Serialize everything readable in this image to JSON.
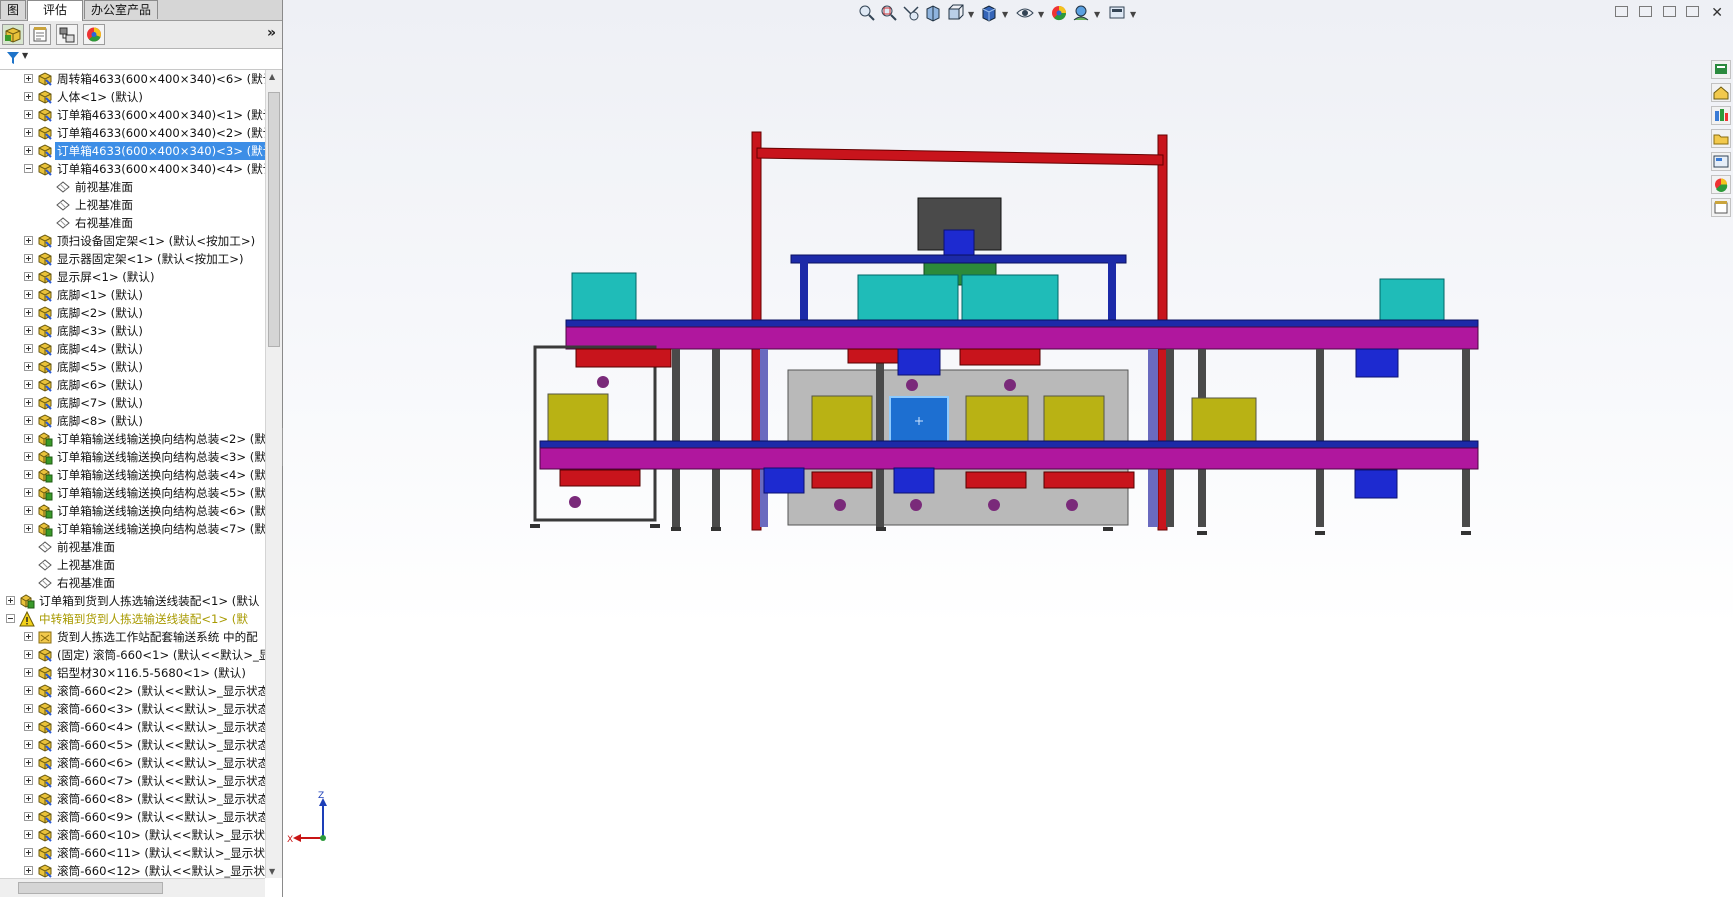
{
  "tabs": [
    {
      "label": "图"
    },
    {
      "label": "评估"
    },
    {
      "label": "办公室产品"
    }
  ],
  "feature_manager": {
    "toolbar_icons": [
      "feature-tree-icon",
      "property-manager-icon",
      "configuration-manager-icon",
      "display-manager-icon"
    ],
    "expand_glyph": "»",
    "filter_arrow": "▼"
  },
  "tree": [
    {
      "label": "周转箱4633(600×400×340)<6> (默认",
      "level": 1,
      "expander": "plus",
      "icon": "part"
    },
    {
      "label": "人体<1> (默认)",
      "level": 1,
      "expander": "plus",
      "icon": "part"
    },
    {
      "label": "订单箱4633(600×400×340)<1> (默认",
      "level": 1,
      "expander": "plus",
      "icon": "part"
    },
    {
      "label": "订单箱4633(600×400×340)<2> (默认",
      "level": 1,
      "expander": "plus",
      "icon": "part"
    },
    {
      "label": "订单箱4633(600×400×340)<3> (默认",
      "level": 1,
      "expander": "plus",
      "icon": "part",
      "selected": true
    },
    {
      "label": "订单箱4633(600×400×340)<4> (默认",
      "level": 1,
      "expander": "minus",
      "icon": "part"
    },
    {
      "label": "前视基准面",
      "level": 2,
      "expander": "none",
      "icon": "plane"
    },
    {
      "label": "上视基准面",
      "level": 2,
      "expander": "none",
      "icon": "plane"
    },
    {
      "label": "右视基准面",
      "level": 2,
      "expander": "none",
      "icon": "plane"
    },
    {
      "label": "顶扫设备固定架<1> (默认<按加工>)",
      "level": 1,
      "expander": "plus",
      "icon": "part"
    },
    {
      "label": "显示器固定架<1> (默认<按加工>)",
      "level": 1,
      "expander": "plus",
      "icon": "part"
    },
    {
      "label": "显示屏<1> (默认)",
      "level": 1,
      "expander": "plus",
      "icon": "part"
    },
    {
      "label": "底脚<1> (默认)",
      "level": 1,
      "expander": "plus",
      "icon": "part"
    },
    {
      "label": "底脚<2> (默认)",
      "level": 1,
      "expander": "plus",
      "icon": "part"
    },
    {
      "label": "底脚<3> (默认)",
      "level": 1,
      "expander": "plus",
      "icon": "part"
    },
    {
      "label": "底脚<4> (默认)",
      "level": 1,
      "expander": "plus",
      "icon": "part"
    },
    {
      "label": "底脚<5> (默认)",
      "level": 1,
      "expander": "plus",
      "icon": "part"
    },
    {
      "label": "底脚<6> (默认)",
      "level": 1,
      "expander": "plus",
      "icon": "part"
    },
    {
      "label": "底脚<7> (默认)",
      "level": 1,
      "expander": "plus",
      "icon": "part"
    },
    {
      "label": "底脚<8> (默认)",
      "level": 1,
      "expander": "plus",
      "icon": "part"
    },
    {
      "label": "订单箱输送线输送换向结构总装<2> (默",
      "level": 1,
      "expander": "plus",
      "icon": "assembly"
    },
    {
      "label": "订单箱输送线输送换向结构总装<3> (默",
      "level": 1,
      "expander": "plus",
      "icon": "assembly"
    },
    {
      "label": "订单箱输送线输送换向结构总装<4> (默",
      "level": 1,
      "expander": "plus",
      "icon": "assembly"
    },
    {
      "label": "订单箱输送线输送换向结构总装<5> (默",
      "level": 1,
      "expander": "plus",
      "icon": "assembly"
    },
    {
      "label": "订单箱输送线输送换向结构总装<6> (默",
      "level": 1,
      "expander": "plus",
      "icon": "assembly"
    },
    {
      "label": "订单箱输送线输送换向结构总装<7> (默",
      "level": 1,
      "expander": "plus",
      "icon": "assembly"
    },
    {
      "label": "前视基准面",
      "level": 1,
      "expander": "none",
      "icon": "plane"
    },
    {
      "label": "上视基准面",
      "level": 1,
      "expander": "none",
      "icon": "plane"
    },
    {
      "label": "右视基准面",
      "level": 1,
      "expander": "none",
      "icon": "plane"
    },
    {
      "label": "订单箱到货到人拣选输送线装配<1> (默认",
      "level": 0,
      "expander": "plus",
      "icon": "assembly"
    },
    {
      "label": "中转箱到货到人拣选输送线装配<1> (默",
      "level": 0,
      "expander": "minus",
      "icon": "warning",
      "warning": true
    },
    {
      "label": "货到人拣选工作站配套输送系统 中的配",
      "level": 1,
      "expander": "plus",
      "icon": "layout"
    },
    {
      "label": "(固定) 滚筒-660<1> (默认<<默认>_显",
      "level": 1,
      "expander": "plus",
      "icon": "part"
    },
    {
      "label": "铝型材30×116.5-5680<1> (默认)",
      "level": 1,
      "expander": "plus",
      "icon": "part"
    },
    {
      "label": "滚筒-660<2> (默认<<默认>_显示状态",
      "level": 1,
      "expander": "plus",
      "icon": "part"
    },
    {
      "label": "滚筒-660<3> (默认<<默认>_显示状态",
      "level": 1,
      "expander": "plus",
      "icon": "part"
    },
    {
      "label": "滚筒-660<4> (默认<<默认>_显示状态",
      "level": 1,
      "expander": "plus",
      "icon": "part"
    },
    {
      "label": "滚筒-660<5> (默认<<默认>_显示状态",
      "level": 1,
      "expander": "plus",
      "icon": "part"
    },
    {
      "label": "滚筒-660<6> (默认<<默认>_显示状态",
      "level": 1,
      "expander": "plus",
      "icon": "part"
    },
    {
      "label": "滚筒-660<7> (默认<<默认>_显示状态",
      "level": 1,
      "expander": "plus",
      "icon": "part"
    },
    {
      "label": "滚筒-660<8> (默认<<默认>_显示状态",
      "level": 1,
      "expander": "plus",
      "icon": "part"
    },
    {
      "label": "滚筒-660<9> (默认<<默认>_显示状态",
      "level": 1,
      "expander": "plus",
      "icon": "part"
    },
    {
      "label": "滚筒-660<10> (默认<<默认>_显示状",
      "level": 1,
      "expander": "plus",
      "icon": "part"
    },
    {
      "label": "滚筒-660<11> (默认<<默认>_显示状",
      "level": 1,
      "expander": "plus",
      "icon": "part"
    },
    {
      "label": "滚筒-660<12> (默认<<默认>_显示状",
      "level": 1,
      "expander": "plus",
      "icon": "part"
    }
  ],
  "heads_up_toolbar": [
    "zoom-to-fit-icon",
    "zoom-to-area-icon",
    "previous-view-icon",
    "section-view-icon",
    "view-orientation-icon",
    "display-style-icon",
    "hide-show-items-icon",
    "edit-appearance-icon",
    "apply-scene-icon",
    "view-settings-icon"
  ],
  "window_controls": {
    "close_glyph": "✕"
  },
  "task_pane": [
    "solidworks-resources-icon",
    "home-icon",
    "design-library-icon",
    "file-explorer-icon",
    "view-palette-icon",
    "appearances-icon",
    "custom-properties-icon"
  ],
  "triad": {
    "z_label": "Z",
    "x_label": "X"
  },
  "colors": {
    "selection": "#3d8ee6",
    "frame_red": "#c8141c",
    "conveyor_magenta": "#b0179e",
    "conveyor_blue": "#1c2aa8",
    "box_teal": "#1fbcb8",
    "box_yellow": "#b9b214",
    "selected_box": "#1d6fd1",
    "frame_grey": "#4a4a4a",
    "warning_text": "#a89a00"
  }
}
